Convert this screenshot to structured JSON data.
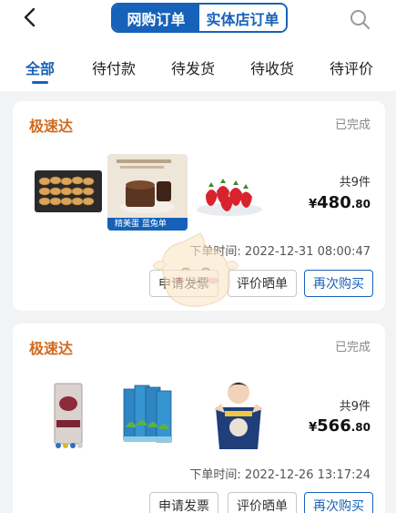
{
  "header": {
    "back_icon": "chevron-left-icon",
    "tabs": [
      "网购订单",
      "实体店订单"
    ],
    "search_icon": "search-icon"
  },
  "filters": [
    "全部",
    "待付款",
    "待发货",
    "待收货",
    "待评价"
  ],
  "orders": [
    {
      "store": "极速达",
      "status": "已完成",
      "count": "共9件",
      "price_symbol": "¥",
      "price_int": "480",
      "price_dec": ".80",
      "time": "下单时间: 2022-12-31 08:00:47",
      "actions": [
        "申请发票",
        "评价晒单",
        "再次购买"
      ],
      "banner_text": "精美蛋 蓝兔单"
    },
    {
      "store": "极速达",
      "status": "已完成",
      "count": "共9件",
      "price_symbol": "¥",
      "price_int": "566",
      "price_dec": ".80",
      "time": "下单时间: 2022-12-26 13:17:24",
      "actions": [
        "申请发票",
        "评价晒单",
        "再次购买"
      ]
    }
  ],
  "colors": {
    "accent": "#1662b8",
    "store": "#d26a1e",
    "bg": "#f2f3f5"
  }
}
